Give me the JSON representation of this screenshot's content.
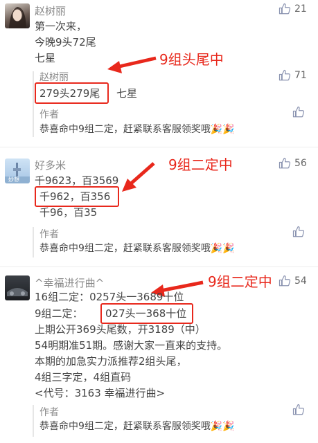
{
  "comments": [
    {
      "user": "赵树丽",
      "likes": "21",
      "lines": [
        "第一次来，",
        "今晚9头72尾",
        "七星"
      ],
      "reply": {
        "user": "赵树丽",
        "likes": "71",
        "highlight": "279头279尾",
        "rest": "七星"
      },
      "author_reply": {
        "user": "作者",
        "text": "恭喜命中9组二定，赶紧联系客服领奖哦🎉🎉"
      }
    },
    {
      "user": "好多米",
      "likes": "56",
      "lines": [
        "千9623，百3569",
        "千962，百356",
        "千96，百35"
      ],
      "author_reply": {
        "user": "作者",
        "text": "恭喜命中9组二定，赶紧联系客服领奖哦🎉🎉"
      }
    },
    {
      "user": "^幸福进行曲^",
      "likes": "54",
      "lines": [
        "16组二定：0257头一3689十位",
        "9组二定：",
        "027头一368十位",
        "上期公开369头尾数，开3189（中）",
        "54明期准51期。感谢大家一直来的支持。",
        "本期的加急实力派推荐2组头尾，",
        "4组三字定，4组直码",
        "<代号：3163  幸福进行曲>"
      ],
      "author_reply": {
        "user": "作者",
        "text": "恭喜命中9组二定，赶紧联系客服领奖哦🎉🎉"
      }
    }
  ],
  "annotations": [
    "9组头尾中",
    "9组二定中",
    "9组二定中"
  ],
  "colors": {
    "annotation": "#e8281c",
    "username": "#8a8a8a"
  },
  "icons": {
    "like": "thumbs-up-icon",
    "party": "party-popper-icon"
  }
}
